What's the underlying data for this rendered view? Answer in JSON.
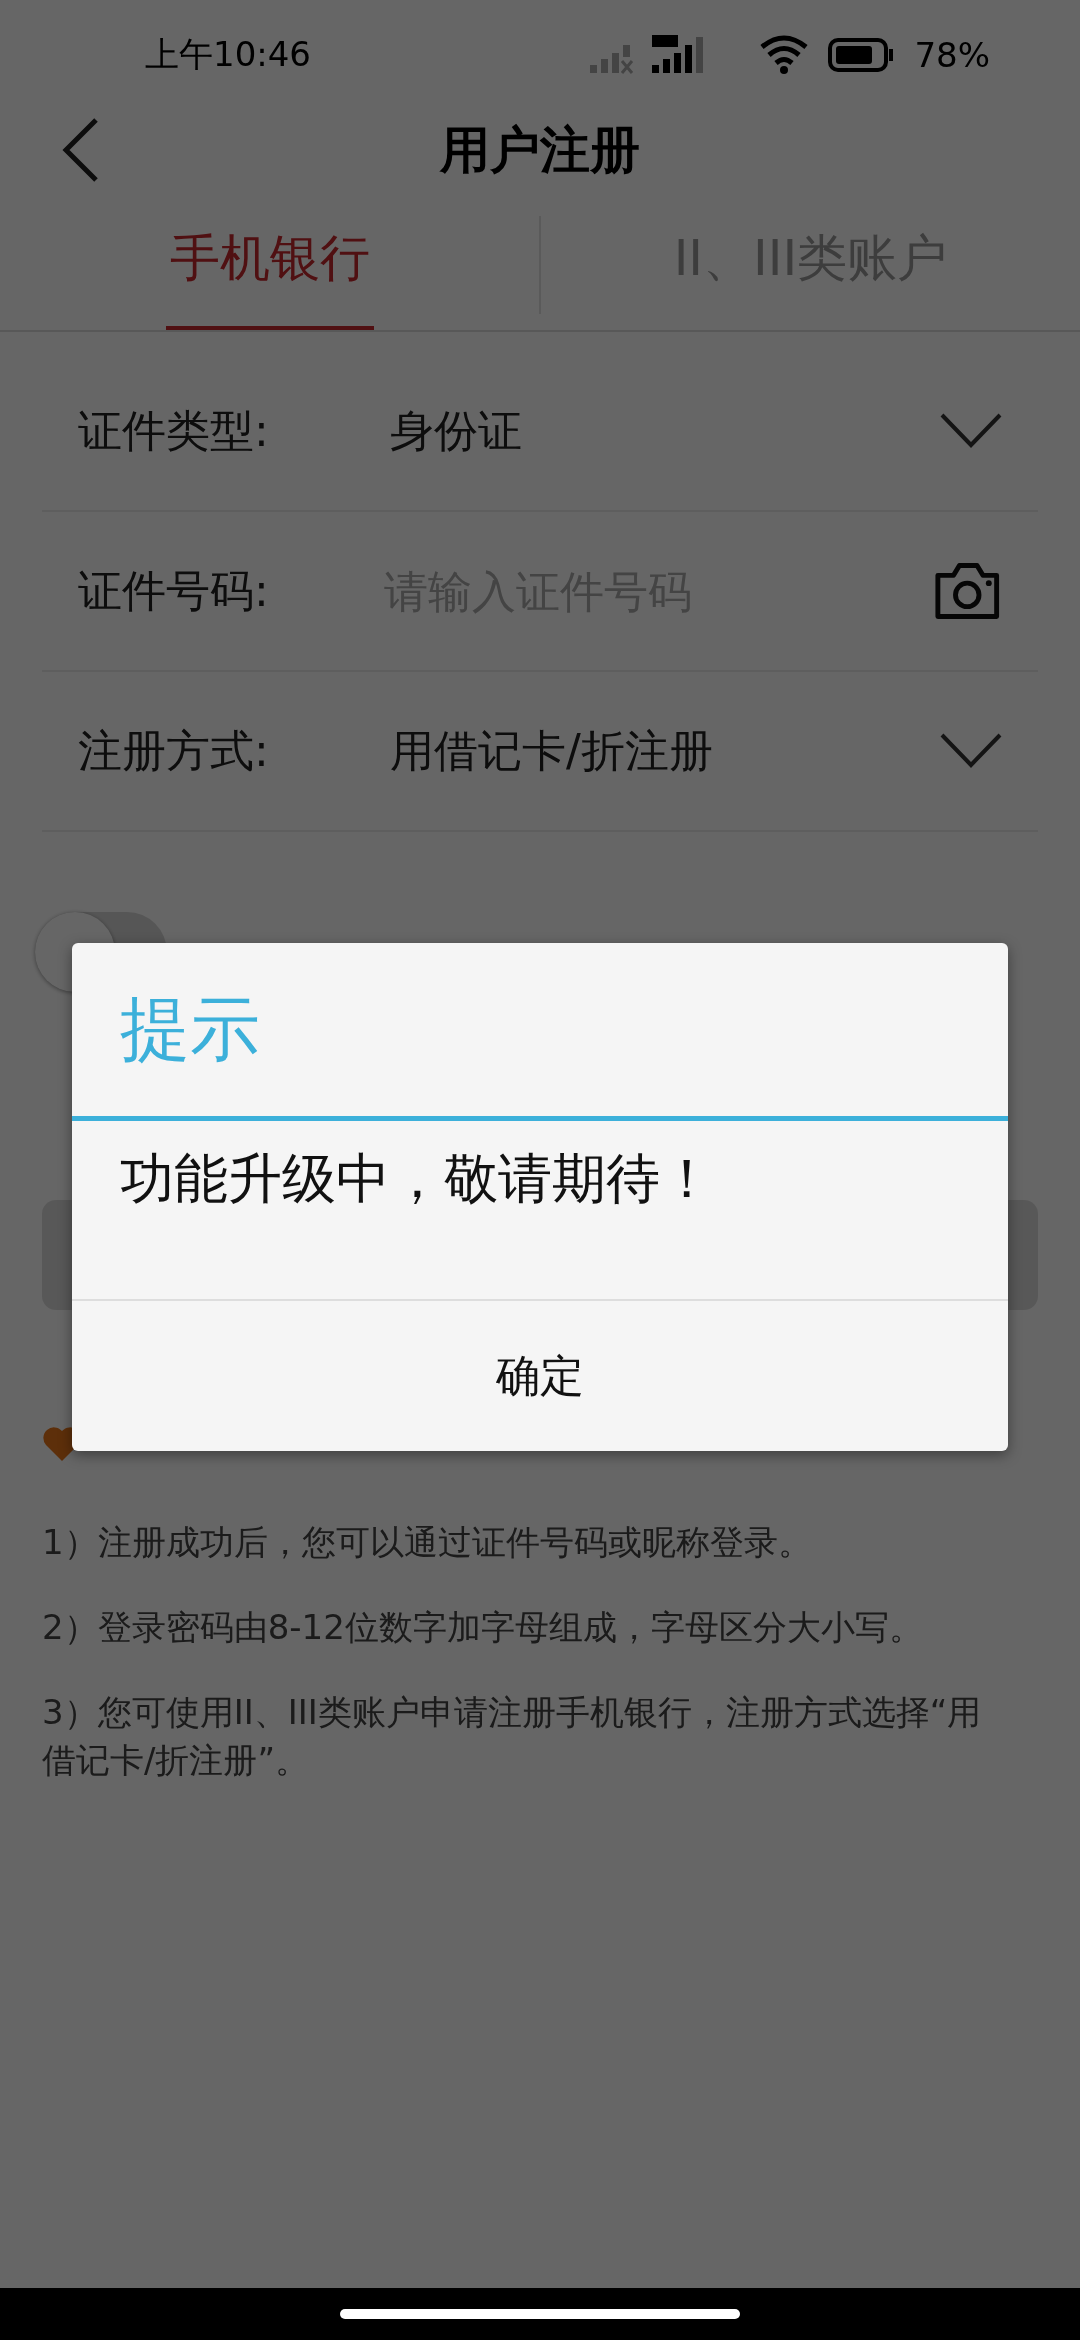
{
  "status_bar": {
    "time": "上午10:46",
    "battery": "78%"
  },
  "header": {
    "title": "用户注册"
  },
  "tabs": [
    {
      "label": "手机银行",
      "selected": true
    },
    {
      "label": "II、III类账户",
      "selected": false
    }
  ],
  "form": [
    {
      "kind": "select",
      "label": "证件类型:",
      "value": "身份证"
    },
    {
      "kind": "input",
      "label": "证件号码:",
      "placeholder": "请输入证件号码"
    },
    {
      "kind": "select",
      "label": "注册方式:",
      "value": "用借记卡/折注册"
    }
  ],
  "agreement": {
    "checked": false
  },
  "tips": [
    "1）注册成功后，您可以通过证件号码或昵称登录。",
    "2）登录密码由8-12位数字加字母组成，字母区分大小写。",
    "3）您可使用II、III类账户申请注册手机银行，注册方式选择“用借记卡/折注册”。"
  ],
  "dialog": {
    "title": "提示",
    "message": "功能升级中，敬请期待！",
    "button": "确定"
  }
}
